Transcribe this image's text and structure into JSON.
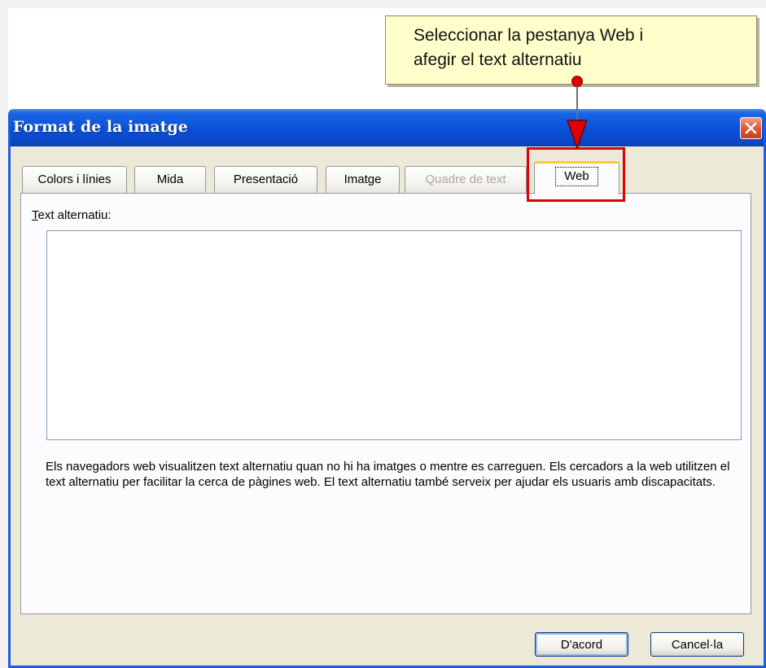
{
  "callout": {
    "line1": "Seleccionar la pestanya Web i",
    "line2": "afegir el text alternatiu"
  },
  "dialog": {
    "title": "Format de la imatge",
    "tabs": [
      {
        "label": "Colors i línies",
        "state": "normal"
      },
      {
        "label": "Mida",
        "state": "normal"
      },
      {
        "label": "Presentació",
        "state": "normal"
      },
      {
        "label": "Imatge",
        "state": "normal"
      },
      {
        "label": "Quadre de text",
        "state": "disabled"
      },
      {
        "label": "Web",
        "state": "selected"
      }
    ],
    "field_label_first": "T",
    "field_label_rest": "ext alternatiu:",
    "alt_text_value": "",
    "help_text": "Els navegadors web visualitzen text alternatiu quan no hi ha imatges o mentre es carreguen. Els cercadors a la web utilitzen el text alternatiu per facilitar la cerca de pàgines web. El text alternatiu també serveix per ajudar els usuaris amb discapacitats.",
    "ok_label": "D'acord",
    "cancel_label": "Cancel·la"
  },
  "colors": {
    "titlebar": "#0a4fd6",
    "dialog_background": "#ece9d8",
    "callout_background": "#ffffcc",
    "highlight": "#e00000",
    "active_tab_accent": "#ffc83c"
  },
  "icons": {
    "close": "close-icon",
    "arrow": "down-arrow-icon"
  }
}
